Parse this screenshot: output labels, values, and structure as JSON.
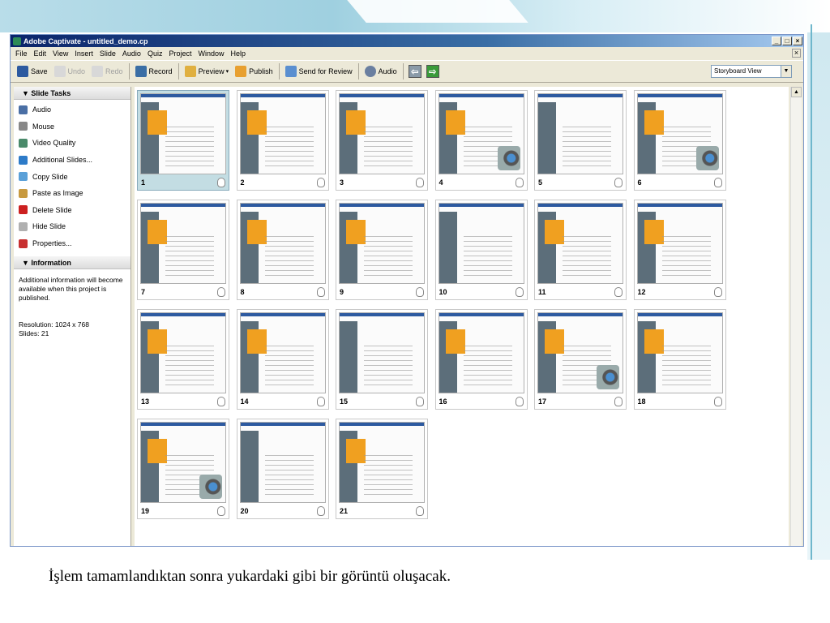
{
  "window": {
    "title": "Adobe Captivate - untitled_demo.cp",
    "buttons": {
      "minimize": "_",
      "restore": "□",
      "close": "×",
      "doc_close": "×"
    }
  },
  "menu": [
    "File",
    "Edit",
    "View",
    "Insert",
    "Slide",
    "Audio",
    "Quiz",
    "Project",
    "Window",
    "Help"
  ],
  "toolbar": {
    "save": "Save",
    "undo": "Undo",
    "redo": "Redo",
    "record": "Record",
    "preview": "Preview",
    "publish": "Publish",
    "send_for_review": "Send for Review",
    "audio": "Audio",
    "back_arrow": "⇦",
    "forward_arrow": "⇨",
    "view_select": "Storyboard View",
    "dropdown_arrow": "▼"
  },
  "slide_tasks": {
    "header": "▼ Slide Tasks",
    "items": [
      {
        "label": "Audio",
        "icon": "speaker-icon",
        "color": "#4a6fa5"
      },
      {
        "label": "Mouse",
        "icon": "mouse-icon",
        "color": "#888888"
      },
      {
        "label": "Video Quality",
        "icon": "video-icon",
        "color": "#4a8a6a"
      },
      {
        "label": "Additional Slides...",
        "icon": "slides-icon",
        "color": "#2d7bc8"
      },
      {
        "label": "Copy Slide",
        "icon": "copy-icon",
        "color": "#5aa0d8"
      },
      {
        "label": "Paste as Image",
        "icon": "paste-icon",
        "color": "#c89a40"
      },
      {
        "label": "Delete Slide",
        "icon": "delete-icon",
        "color": "#cc2020"
      },
      {
        "label": "Hide Slide",
        "icon": "hide-icon",
        "color": "#b0b0b0"
      },
      {
        "label": "Properties...",
        "icon": "properties-icon",
        "color": "#c83030"
      }
    ]
  },
  "information": {
    "header": "▼ Information",
    "line1": "Additional information will become",
    "line2": "available when this project is published.",
    "resolution": "Resolution: 1024 x 768",
    "slides": "Slides: 21"
  },
  "slides": [
    {
      "num": "1",
      "cam": false,
      "selected": true
    },
    {
      "num": "2",
      "cam": false
    },
    {
      "num": "3",
      "cam": false
    },
    {
      "num": "4",
      "cam": true
    },
    {
      "num": "5",
      "cam": false
    },
    {
      "num": "6",
      "cam": true
    },
    {
      "num": "7",
      "cam": false
    },
    {
      "num": "8",
      "cam": false
    },
    {
      "num": "9",
      "cam": false
    },
    {
      "num": "10",
      "cam": false
    },
    {
      "num": "11",
      "cam": false
    },
    {
      "num": "12",
      "cam": false
    },
    {
      "num": "13",
      "cam": false
    },
    {
      "num": "14",
      "cam": false
    },
    {
      "num": "15",
      "cam": false
    },
    {
      "num": "16",
      "cam": false
    },
    {
      "num": "17",
      "cam": true
    },
    {
      "num": "18",
      "cam": false
    },
    {
      "num": "19",
      "cam": true
    },
    {
      "num": "20",
      "cam": false
    },
    {
      "num": "21",
      "cam": false
    }
  ],
  "scrollbar": {
    "up_arrow": "▲"
  },
  "caption": "İşlem tamamlandıktan sonra  yukardaki gibi bir görüntü oluşacak."
}
